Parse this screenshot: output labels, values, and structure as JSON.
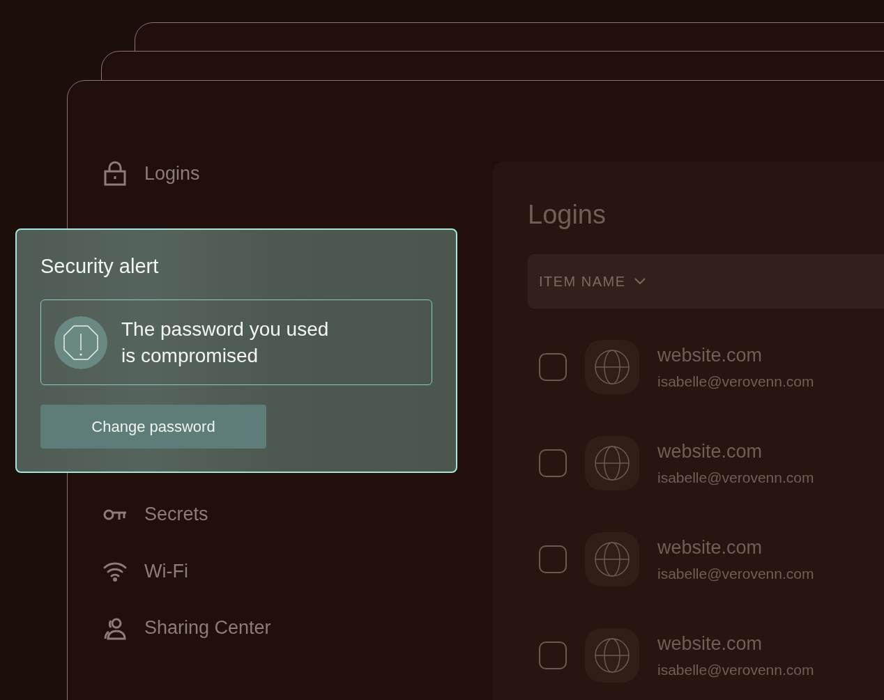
{
  "sidebar": {
    "items": [
      {
        "kind": "lock",
        "label": "Logins"
      },
      {
        "kind": "key",
        "label": "Secrets"
      },
      {
        "kind": "wifi",
        "label": "Wi-Fi"
      },
      {
        "kind": "sharing",
        "label": "Sharing Center"
      }
    ]
  },
  "content": {
    "title": "Logins",
    "column_header": "ITEM NAME",
    "rows": [
      {
        "title": "website.com",
        "subtitle": "isabelle@verovenn.com",
        "checked": false
      },
      {
        "title": "website.com",
        "subtitle": "isabelle@verovenn.com",
        "checked": false
      },
      {
        "title": "website.com",
        "subtitle": "isabelle@verovenn.com",
        "checked": false
      },
      {
        "title": "website.com",
        "subtitle": "isabelle@verovenn.com",
        "checked": false
      }
    ]
  },
  "alert": {
    "title": "Security alert",
    "message": "The password you used is compromised",
    "button": "Change password"
  }
}
